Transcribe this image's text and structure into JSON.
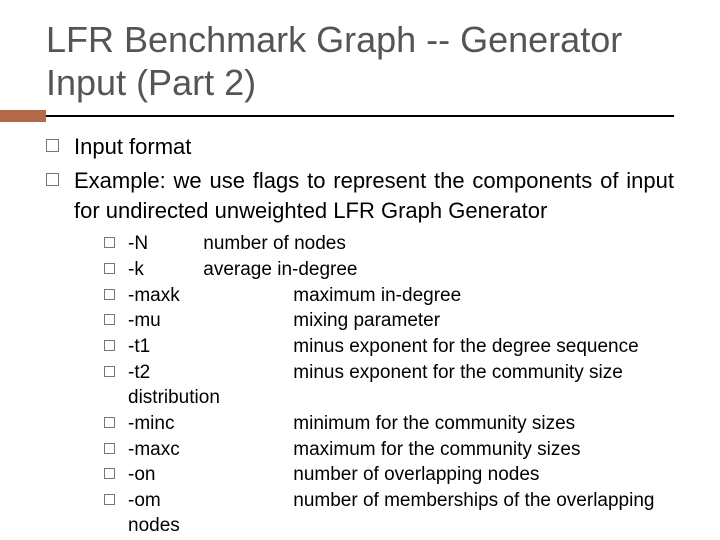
{
  "title": "LFR Benchmark Graph -- Generator Input (Part 2)",
  "level1": [
    {
      "text": "Input format"
    },
    {
      "text": "Example: we use flags to represent the components of input for undirected unweighted LFR Graph Generator"
    }
  ],
  "flags": [
    {
      "flag": "-N",
      "desc": "number of nodes",
      "descPos": "near",
      "cont": ""
    },
    {
      "flag": "-k",
      "desc": "average in-degree",
      "descPos": "near",
      "cont": ""
    },
    {
      "flag": "-maxk",
      "desc": "maximum in-degree",
      "descPos": "mid",
      "cont": ""
    },
    {
      "flag": "-mu",
      "desc": "mixing parameter",
      "descPos": "mid",
      "cont": ""
    },
    {
      "flag": "-t1",
      "desc": "minus exponent for the degree sequence",
      "descPos": "mid",
      "cont": ""
    },
    {
      "flag": "-t2",
      "desc": "minus exponent for the community size",
      "descPos": "mid",
      "cont": "distribution"
    },
    {
      "flag": "-minc",
      "desc": "minimum for the community sizes",
      "descPos": "mid",
      "cont": ""
    },
    {
      "flag": "-maxc",
      "desc": "maximum for the community sizes",
      "descPos": "mid",
      "cont": ""
    },
    {
      "flag": "-on",
      "desc": "number of overlapping nodes",
      "descPos": "mid",
      "cont": ""
    },
    {
      "flag": "-om",
      "desc": "number of memberships of the overlapping",
      "descPos": "mid",
      "cont": "nodes"
    }
  ]
}
